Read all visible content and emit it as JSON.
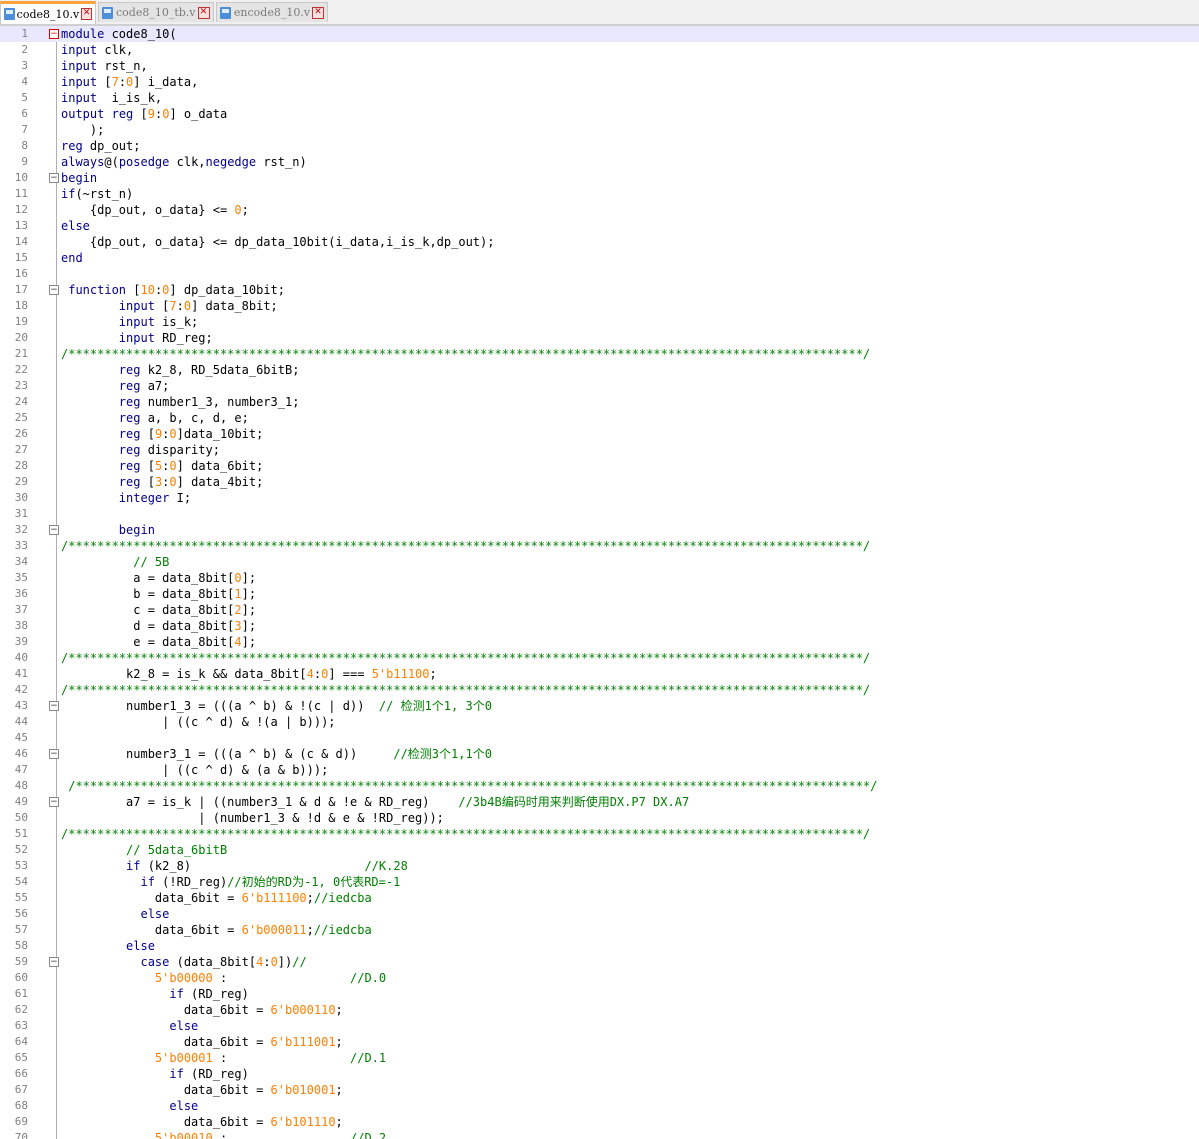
{
  "tabs": [
    {
      "label": "code8_10.v",
      "active": true
    },
    {
      "label": "code8_10_tb.v",
      "active": false
    },
    {
      "label": "encode8_10.v",
      "active": false
    }
  ],
  "lines": [
    [
      1,
      "[k]module[/k] code8_10("
    ],
    [
      2,
      "[k]input[/k] clk,"
    ],
    [
      3,
      "[k]input[/k] rst_n,"
    ],
    [
      4,
      "[k]input[/k] [[n]7[/n]:[n]0[/n]] i_data,"
    ],
    [
      5,
      "[k]input[/k]  i_is_k,"
    ],
    [
      6,
      "[k]output[/k] [k]reg[/k] [[n]9[/n]:[n]0[/n]] o_data"
    ],
    [
      7,
      "    );"
    ],
    [
      8,
      "[k]reg[/k] dp_out;"
    ],
    [
      9,
      "[k]always[/k]@([k]posedge[/k] clk,[k]negedge[/k] rst_n)"
    ],
    [
      10,
      "[k]begin[/k]"
    ],
    [
      11,
      "[k]if[/k](~rst_n)"
    ],
    [
      12,
      "    {dp_out, o_data} <= [n]0[/n];"
    ],
    [
      13,
      "[k]else[/k]"
    ],
    [
      14,
      "    {dp_out, o_data} <= dp_data_10bit(i_data,i_is_k,dp_out);"
    ],
    [
      15,
      "[k]end[/k]"
    ],
    [
      16,
      ""
    ],
    [
      17,
      " [k]function[/k] [[n]10[/n]:[n]0[/n]] dp_data_10bit;"
    ],
    [
      18,
      "        [k]input[/k] [[n]7[/n]:[n]0[/n]] data_8bit;"
    ],
    [
      19,
      "        [k]input[/k] is_k;"
    ],
    [
      20,
      "        [k]input[/k] RD_reg;"
    ],
    [
      21,
      "[c]/**************************************************************************************************************/[/c]"
    ],
    [
      22,
      "        [k]reg[/k] k2_8, RD_5data_6bitB;"
    ],
    [
      23,
      "        [k]reg[/k] a7;"
    ],
    [
      24,
      "        [k]reg[/k] number1_3, number3_1;"
    ],
    [
      25,
      "        [k]reg[/k] a, b, c, d, e;"
    ],
    [
      26,
      "        [k]reg[/k] [[n]9[/n]:[n]0[/n]]data_10bit;"
    ],
    [
      27,
      "        [k]reg[/k] disparity;"
    ],
    [
      28,
      "        [k]reg[/k] [[n]5[/n]:[n]0[/n]] data_6bit;"
    ],
    [
      29,
      "        [k]reg[/k] [[n]3[/n]:[n]0[/n]] data_4bit;"
    ],
    [
      30,
      "        [k]integer[/k] I;"
    ],
    [
      31,
      ""
    ],
    [
      32,
      "        [k]begin[/k]"
    ],
    [
      33,
      "[c]/**************************************************************************************************************/[/c]"
    ],
    [
      34,
      "          [c]// 5B[/c]"
    ],
    [
      35,
      "          a = data_8bit[[n]0[/n]];"
    ],
    [
      36,
      "          b = data_8bit[[n]1[/n]];"
    ],
    [
      37,
      "          c = data_8bit[[n]2[/n]];"
    ],
    [
      38,
      "          d = data_8bit[[n]3[/n]];"
    ],
    [
      39,
      "          e = data_8bit[[n]4[/n]];"
    ],
    [
      40,
      "[c]/**************************************************************************************************************/[/c]"
    ],
    [
      41,
      "         k2_8 = is_k && data_8bit[[n]4[/n]:[n]0[/n]] === [n]5'b11100[/n];"
    ],
    [
      42,
      "[c]/**************************************************************************************************************/[/c]"
    ],
    [
      43,
      "         number1_3 = (((a ^ b) & !(c | d))  [c]// 检测1个1, 3个0[/c]"
    ],
    [
      44,
      "              | ((c ^ d) & !(a | b)));"
    ],
    [
      45,
      ""
    ],
    [
      46,
      "         number3_1 = (((a ^ b) & (c & d))     [c]//检测3个1,1个0[/c]"
    ],
    [
      47,
      "              | ((c ^ d) & (a & b)));"
    ],
    [
      48,
      " [c]/**************************************************************************************************************/[/c]"
    ],
    [
      49,
      "         a7 = is_k | ((number3_1 & d & !e & RD_reg)    [c]//3b4B编码时用来判断使用DX.P7 DX.A7[/c]"
    ],
    [
      50,
      "                   | (number1_3 & !d & e & !RD_reg));"
    ],
    [
      51,
      "[c]/**************************************************************************************************************/[/c]"
    ],
    [
      52,
      "         [c]// 5data_6bitB[/c]"
    ],
    [
      53,
      "         [k]if[/k] (k2_8)                        [c]//K.28[/c]"
    ],
    [
      54,
      "           [k]if[/k] (!RD_reg)[c]//初始的RD为-1, 0代表RD=-1[/c]"
    ],
    [
      55,
      "             data_6bit = [n]6'b111100[/n];[c]//iedcba[/c]"
    ],
    [
      56,
      "           [k]else[/k]"
    ],
    [
      57,
      "             data_6bit = [n]6'b000011[/n];[c]//iedcba[/c]"
    ],
    [
      58,
      "         [k]else[/k]"
    ],
    [
      59,
      "           [k]case[/k] (data_8bit[[n]4[/n]:[n]0[/n]])[c]//[/c]"
    ],
    [
      60,
      "             [n]5'b00000[/n] :                 [c]//D.0[/c]"
    ],
    [
      61,
      "               [k]if[/k] (RD_reg)"
    ],
    [
      62,
      "                 data_6bit = [n]6'b000110[/n];"
    ],
    [
      63,
      "               [k]else[/k]"
    ],
    [
      64,
      "                 data_6bit = [n]6'b111001[/n];"
    ],
    [
      65,
      "             [n]5'b00001[/n] :                 [c]//D.1[/c]"
    ],
    [
      66,
      "               [k]if[/k] (RD_reg)"
    ],
    [
      67,
      "                 data_6bit = [n]6'b010001[/n];"
    ],
    [
      68,
      "               [k]else[/k]"
    ],
    [
      69,
      "                 data_6bit = [n]6'b101110[/n];"
    ],
    [
      70,
      "             [n]5'b00010[/n] :                 [c]//D.2[/c]"
    ]
  ],
  "folds": {
    "1": "minus",
    "10": "minus",
    "17": "minus",
    "32": "minus",
    "43": "minus",
    "46": "minus",
    "49": "minus",
    "59": "minus"
  }
}
